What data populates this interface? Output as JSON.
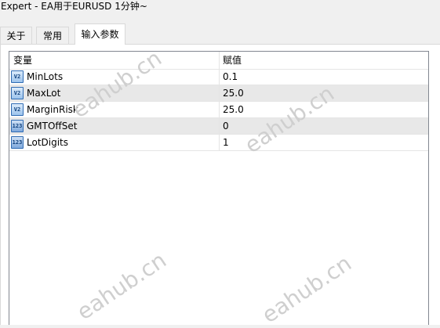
{
  "window": {
    "title": "Expert - EA用于EURUSD 1分钟~"
  },
  "tabs": [
    {
      "label": "关于",
      "active": false
    },
    {
      "label": "常用",
      "active": false
    },
    {
      "label": "输入参数",
      "active": true
    }
  ],
  "grid": {
    "columns": [
      "变量",
      "赋值"
    ],
    "rows": [
      {
        "name": "MinLots",
        "value": "0.1",
        "icon": "double-type-icon",
        "icon_text": "V2"
      },
      {
        "name": "MaxLot",
        "value": "25.0",
        "icon": "double-type-icon",
        "icon_text": "V2"
      },
      {
        "name": "MarginRisk",
        "value": "25.0",
        "icon": "double-type-icon",
        "icon_text": "V2"
      },
      {
        "name": "GMTOffSet",
        "value": "0",
        "icon": "integer-type-icon",
        "icon_text": "123"
      },
      {
        "name": "LotDigits",
        "value": "1",
        "icon": "integer-type-icon",
        "icon_text": "123"
      }
    ]
  },
  "watermark": "eahub.cn"
}
